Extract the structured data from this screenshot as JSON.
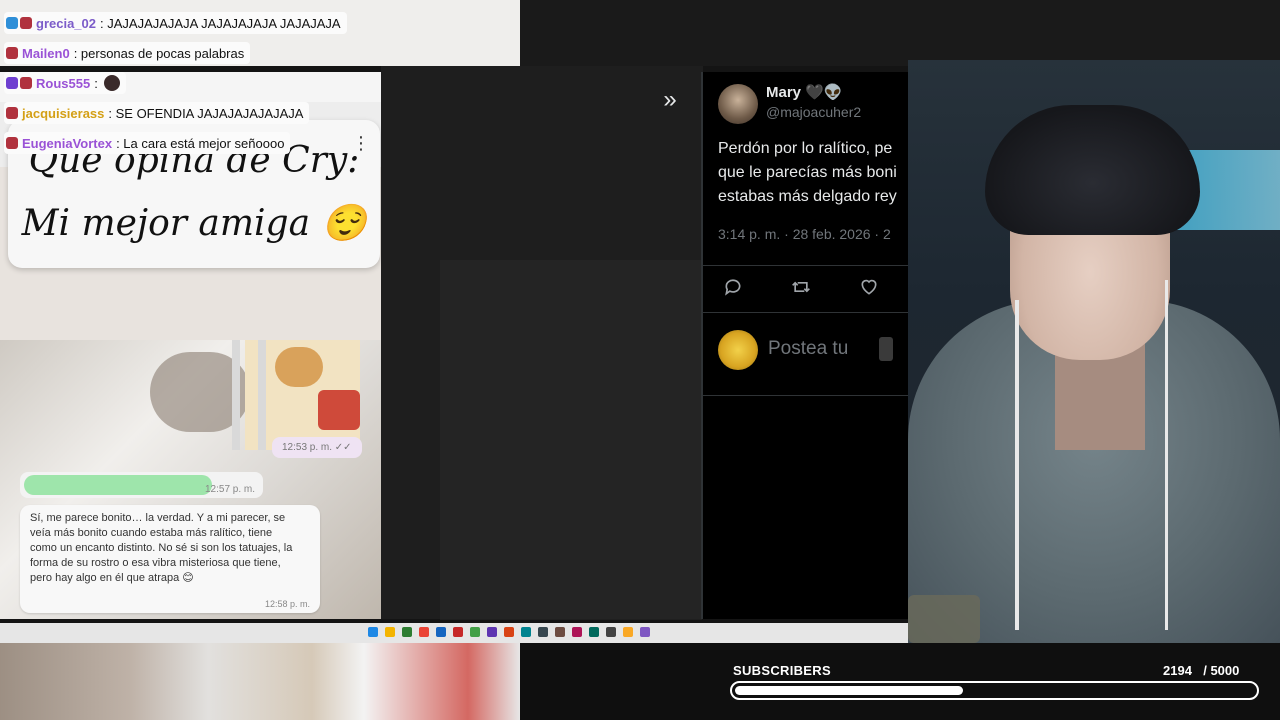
{
  "chat": {
    "messages": [
      {
        "user": "grecia_02",
        "text": ": JAJAJAJAJAJA JAJAJAJAJA JAJAJAJA",
        "color": "#7c5cc9"
      },
      {
        "user": "Mailen0",
        "text": ": personas de pocas palabras",
        "color": "#9a52d6"
      },
      {
        "user": "Rous555",
        "text": ":",
        "color": "#9a52d6"
      },
      {
        "user": "jacquisierass",
        "text": ": SE OFENDIA JAJAJAJAJAJAJA",
        "color": "#d4a017"
      },
      {
        "user": "EugeniaVortex",
        "text": ": La cara está mejor señoooo",
        "color": "#9a52d6"
      }
    ]
  },
  "phone": {
    "sticker_line1": "Que opina de Cry:",
    "sticker_line2": "Mi mejor amiga 😌",
    "photo_time": "12:53 p. m. ✓✓",
    "green_time": "12:57 p. m.",
    "reply_text": "Sí, me parece bonito… la verdad. Y a mi parecer, se veía más bonito cuando estaba más ralítico, tiene como un encanto distinto.  No sé si son los tatuajes, la forma de su rostro o esa vibra misteriosa que tiene, pero hay algo en él que atrapa 😊",
    "reply_time": "12:58 p. m."
  },
  "tweet": {
    "name": "Mary 🖤👽",
    "handle": "@majoacuher2",
    "line1": "Perdón por lo ralítico, pe",
    "line2": "que le parecías más boni",
    "line3": "estabas más delgado rey",
    "meta": "3:14 p. m. · 28 feb. 2026 · 2",
    "compose_placeholder": "Postea tu"
  },
  "subscribers": {
    "label": "SUBSCRIBERS",
    "count": "2194",
    "goal": "  / 5000",
    "progress": 0.4388
  }
}
